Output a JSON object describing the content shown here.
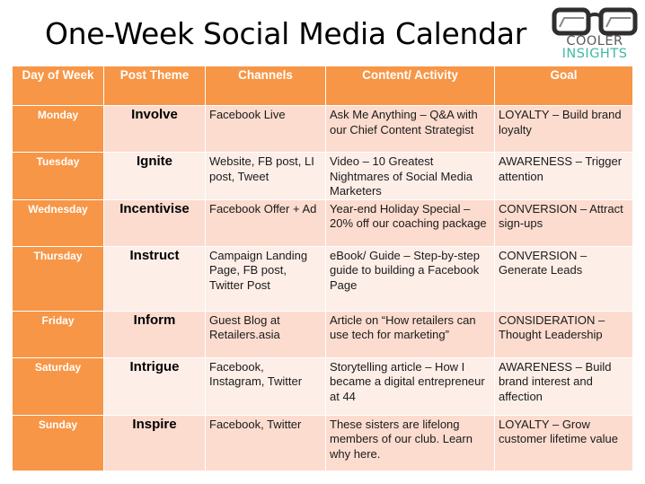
{
  "title": "One-Week Social Media Calendar",
  "logo": {
    "line1": "COOLER",
    "line2": "INSIGHTS",
    "icon": "glasses-icon"
  },
  "colors": {
    "header": "#f79646",
    "row_dark": "#fcdccf",
    "row_light": "#fdeee8",
    "logo_teal": "#3fb8a6"
  },
  "table": {
    "headers": [
      "Day of Week",
      "Post Theme",
      "Channels",
      "Content/ Activity",
      "Goal"
    ],
    "rows": [
      {
        "day": "Monday",
        "theme": "Involve",
        "channels": "Facebook Live",
        "content": "Ask Me Anything – Q&A with our Chief Content Strategist",
        "goal": "LOYALTY – Build brand loyalty"
      },
      {
        "day": "Tuesday",
        "theme": "Ignite",
        "channels": "Website, FB post, LI post, Tweet",
        "content": "Video – 10 Greatest Nightmares of Social Media Marketers",
        "goal": "AWARENESS – Trigger attention"
      },
      {
        "day": "Wednesday",
        "theme": "Incentivise",
        "channels": "Facebook Offer + Ad",
        "content": "Year-end Holiday Special – 20% off our coaching package",
        "goal": "CONVERSION – Attract sign-ups"
      },
      {
        "day": "Thursday",
        "theme": "Instruct",
        "channels": "Campaign Landing Page, FB post, Twitter Post",
        "content": "eBook/ Guide – Step-by-step guide to building a Facebook Page",
        "goal": "CONVERSION – Generate Leads"
      },
      {
        "day": "Friday",
        "theme": "Inform",
        "channels": "Guest Blog at Retailers.asia",
        "content": "Article on “How retailers can use tech for marketing”",
        "goal": "CONSIDERATION – Thought Leadership"
      },
      {
        "day": "Saturday",
        "theme": "Intrigue",
        "channels": "Facebook, Instagram, Twitter",
        "content": "Storytelling article – How I became a digital entrepreneur at 44",
        "goal": "AWARENESS – Build brand interest and affection"
      },
      {
        "day": "Sunday",
        "theme": "Inspire",
        "channels": "Facebook, Twitter",
        "content": "These sisters are lifelong members of our club. Learn why here.",
        "goal": "LOYALTY – Grow customer lifetime value"
      }
    ]
  }
}
